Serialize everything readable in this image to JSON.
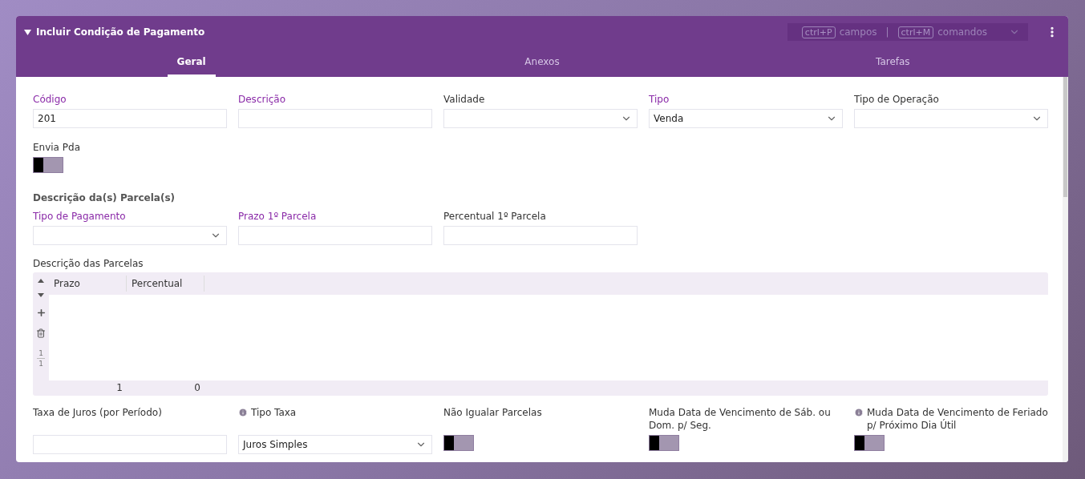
{
  "header": {
    "title": "Incluir Condição de Pagamento",
    "expanded": true,
    "shortcuts": [
      {
        "key": "ctrl+P",
        "label": "campos"
      },
      {
        "key": "ctrl+M",
        "label": "comandos"
      }
    ],
    "separator": "|"
  },
  "tabs": [
    {
      "label": "Geral",
      "selected": true
    },
    {
      "label": "Anexos",
      "selected": false
    },
    {
      "label": "Tarefas",
      "selected": false
    }
  ],
  "top_rows": [
    [
      {
        "kind": "text",
        "label": "Código",
        "required": true,
        "value": "201"
      },
      {
        "kind": "text",
        "label": "Descrição",
        "required": true
      },
      {
        "kind": "select",
        "label": "Validade",
        "required": false
      },
      {
        "kind": "select",
        "label": "Tipo",
        "required": true,
        "value": "Venda"
      },
      {
        "kind": "select",
        "label": "Tipo de Operação",
        "required": false
      }
    ],
    [
      {
        "kind": "toggle",
        "label": "Envia Pda",
        "required": false,
        "on": false
      }
    ]
  ],
  "section_title": "Descrição da(s) Parcela(s)",
  "section_rows": [
    [
      {
        "kind": "select",
        "label": "Tipo de Pagamento",
        "required": true
      },
      {
        "kind": "text",
        "label": "Prazo 1º Parcela",
        "required": true
      },
      {
        "kind": "text",
        "label": "Percentual 1º Parcela",
        "required": false
      }
    ]
  ],
  "grid": {
    "label": "Descrição das Parcelas",
    "columns": [
      {
        "title": "Prazo",
        "total": "1"
      },
      {
        "title": "Percentual",
        "total": "0"
      }
    ],
    "row_counter": {
      "current": "1",
      "total": "1"
    }
  },
  "bottom_rows": [
    [
      {
        "kind": "text",
        "label": "Taxa de Juros (por Período)",
        "required": false,
        "info": false
      },
      {
        "kind": "select",
        "label": "Tipo Taxa",
        "required": false,
        "info": true,
        "value": "Juros Simples"
      },
      {
        "kind": "toggle",
        "label": "Não Igualar Parcelas",
        "required": false,
        "info": false,
        "on": false
      },
      {
        "kind": "toggle",
        "label": "Muda Data de Vencimento de Sáb. ou Dom. p/ Seg.",
        "required": false,
        "info": false,
        "on": false
      },
      {
        "kind": "toggle",
        "label": "Muda Data de Vencimento de Feriado p/ Próximo Dia Útil",
        "required": false,
        "info": true,
        "on": false
      }
    ]
  ]
}
